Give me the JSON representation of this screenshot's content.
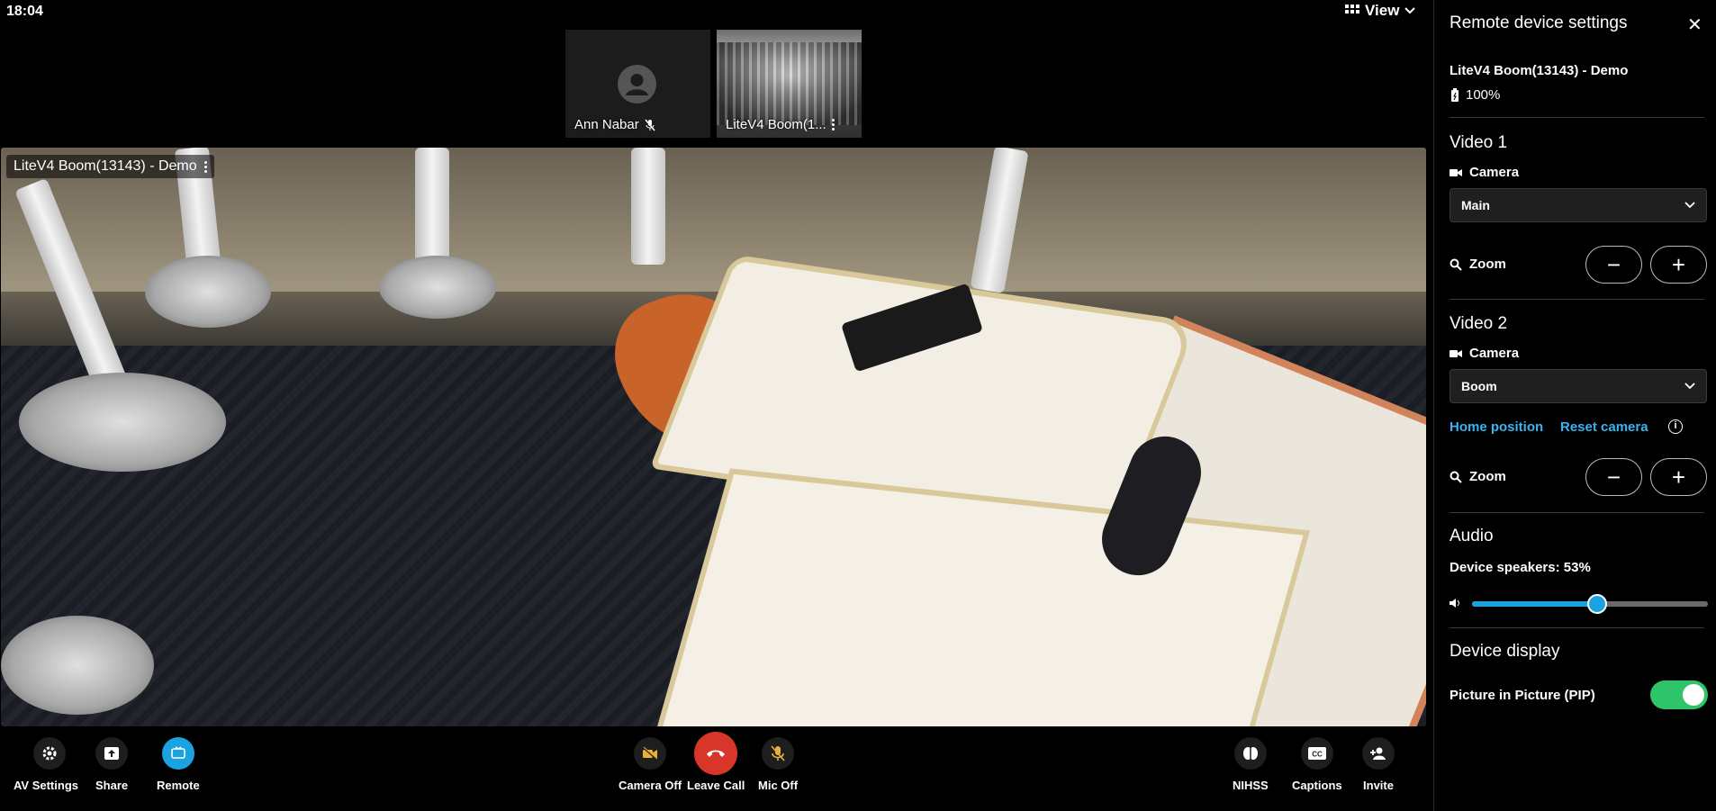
{
  "status": {
    "time": "18:04"
  },
  "header": {
    "view_label": "View"
  },
  "participants": [
    {
      "name": "Ann Nabar",
      "muted": true,
      "icon": "person-icon"
    },
    {
      "name": "LiteV4 Boom(1..."
    }
  ],
  "main_video": {
    "label": "LiteV4 Boom(13143) - Demo"
  },
  "toolbar": {
    "left": [
      {
        "label": "AV Settings",
        "icon": "gear-icon"
      },
      {
        "label": "Share",
        "icon": "share-icon"
      },
      {
        "label": "Remote",
        "icon": "remote-icon",
        "active": true
      }
    ],
    "center": [
      {
        "label": "Camera Off",
        "icon": "camera-off-icon"
      },
      {
        "label": "Leave Call",
        "icon": "hangup-icon"
      },
      {
        "label": "Mic Off",
        "icon": "mic-off-icon"
      }
    ],
    "right": [
      {
        "label": "NIHSS",
        "icon": "brain-icon"
      },
      {
        "label": "Captions",
        "icon": "cc-icon"
      },
      {
        "label": "Invite",
        "icon": "add-person-icon"
      }
    ]
  },
  "panel": {
    "title": "Remote device settings",
    "device_name": "LiteV4 Boom(13143) - Demo",
    "battery": "100%",
    "video1": {
      "heading": "Video 1",
      "camera_label": "Camera",
      "camera_value": "Main",
      "zoom_label": "Zoom"
    },
    "video2": {
      "heading": "Video 2",
      "camera_label": "Camera",
      "camera_value": "Boom",
      "home_position": "Home position",
      "reset_camera": "Reset camera",
      "zoom_label": "Zoom"
    },
    "audio": {
      "heading": "Audio",
      "speakers_label": "Device speakers: 53%",
      "speakers_level": 0.53
    },
    "display": {
      "heading": "Device display",
      "pip_label": "Picture in Picture (PIP)",
      "pip_on": true
    }
  },
  "colors": {
    "accent": "#1aa3e0",
    "danger": "#d9362b",
    "toggle_on": "#2ec46a",
    "link": "#3ab3f0"
  }
}
